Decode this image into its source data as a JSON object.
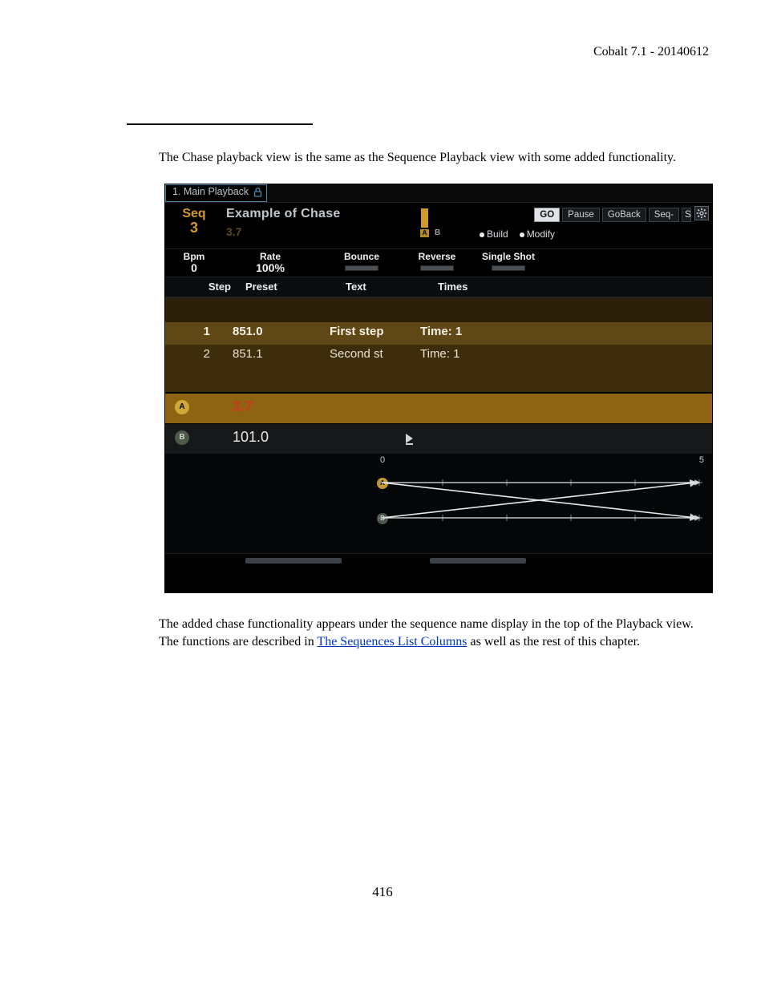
{
  "doc": {
    "header_right": "Cobalt 7.1 - 20140612",
    "intro": "The Chase playback view is the same as the Sequence Playback view with some added functionality.",
    "body_before_link": "The added chase functionality appears under the sequence name display in the top of the Playback view. The functions are described in ",
    "link_text": "The Sequences List Columns",
    "body_after_link": " as well as the rest of this chapter.",
    "page_number": "416"
  },
  "ui": {
    "title_tab": "1. Main Playback",
    "seq": {
      "label": "Seq",
      "num": "3",
      "name": "Example of Chase",
      "sub": "3.7"
    },
    "ab_chip": {
      "a": "A",
      "b": "B"
    },
    "buttons": {
      "go": "GO",
      "pause": "Pause",
      "goback": "GoBack",
      "seq": "Seq-",
      "clipped": "S"
    },
    "radios": {
      "build": "Build",
      "modify": "Modify"
    },
    "params": {
      "bpm_label": "Bpm",
      "bpm_value": "0",
      "rate_label": "Rate",
      "rate_value": "100%",
      "bounce": "Bounce",
      "reverse": "Reverse",
      "single": "Single Shot"
    },
    "columns": {
      "step": "Step",
      "preset": "Preset",
      "text": "Text",
      "times": "Times"
    },
    "steps": [
      {
        "n": "1",
        "preset": "851.0",
        "text": "First step",
        "times": "Time: 1"
      },
      {
        "n": "2",
        "preset": "851.1",
        "text": "Second st",
        "times": "Time: 1"
      }
    ],
    "ab": {
      "a_label": "A",
      "a_value": "3.7",
      "b_label": "B",
      "b_value": "101.0"
    },
    "cross": {
      "left": "0",
      "right": "5",
      "pA": "A",
      "pB": "B"
    }
  }
}
